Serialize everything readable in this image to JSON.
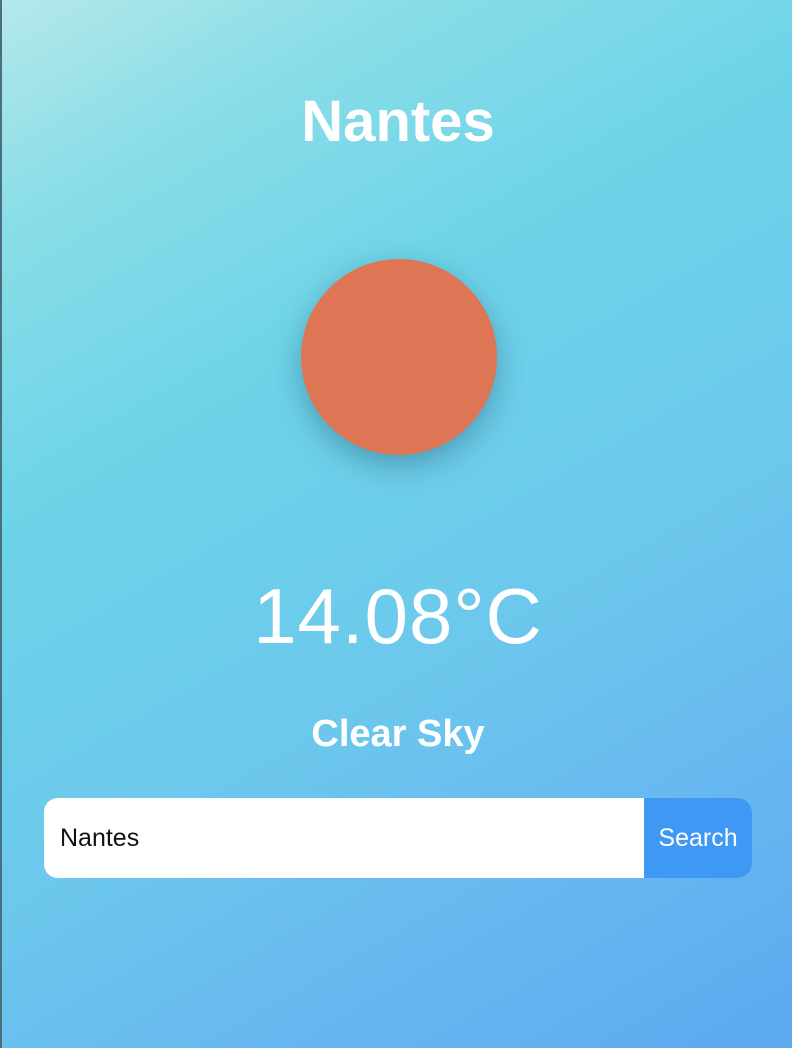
{
  "weather": {
    "city": "Nantes",
    "icon": "sun-icon",
    "icon_color": "#de7655",
    "temperature": "14.08°C",
    "description": "Clear Sky"
  },
  "search": {
    "value": "Nantes",
    "button_label": "Search",
    "button_color": "#3f98f4"
  }
}
